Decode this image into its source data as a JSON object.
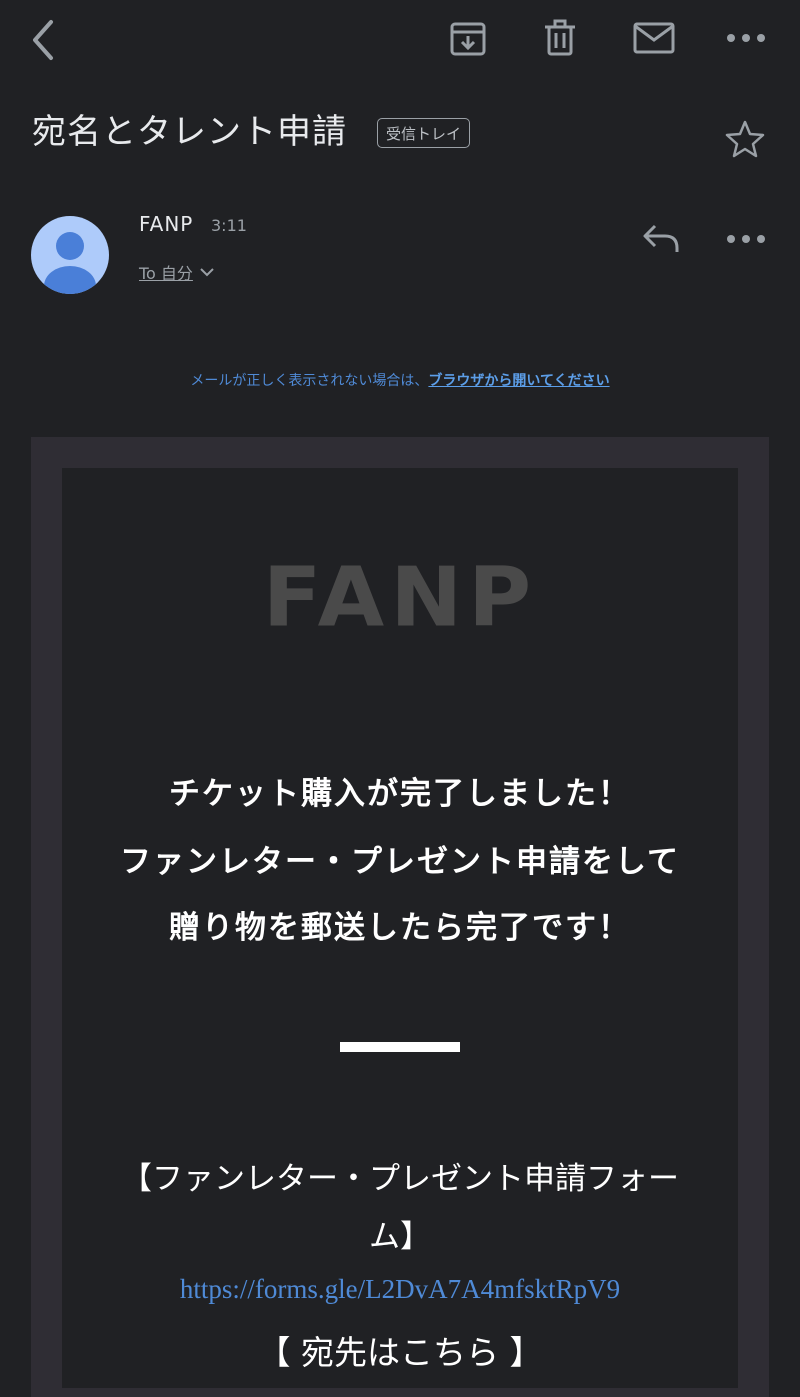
{
  "toolbar": {
    "back_icon": "back-arrow-icon",
    "archive_icon": "archive-icon",
    "delete_icon": "trash-icon",
    "mark_unread_icon": "envelope-icon",
    "more_icon": "more-dots-icon"
  },
  "header": {
    "subject": "宛名とタレント申請",
    "label_badge": "受信トレイ",
    "star_icon": "star-outline-icon"
  },
  "sender": {
    "name": "FANP",
    "time": "3:11",
    "recipient": "To 自分",
    "avatar_color": "#aecbfa",
    "avatar_figure_color": "#4a7fd8"
  },
  "notice": {
    "prefix": "メールが正しく表示されない場合は、",
    "link": "ブラウザから開いてください"
  },
  "email_body": {
    "logo": "FANP",
    "headline": [
      "チケット購入が完了しました！",
      "ファンレター・プレゼント申請をして",
      "贈り物を郵送したら完了です！"
    ],
    "form_title": "【ファンレター・プレゼント申請フォーム】",
    "form_url": "https://forms.gle/L2DvA7A4mfsktRpV9",
    "address_title": "【 宛先はこちら 】"
  },
  "colors": {
    "background": "#202124",
    "frame": "#2f2d34",
    "link": "#4f8ad6",
    "text": "#e8eaed",
    "muted": "#9aa0a6"
  }
}
